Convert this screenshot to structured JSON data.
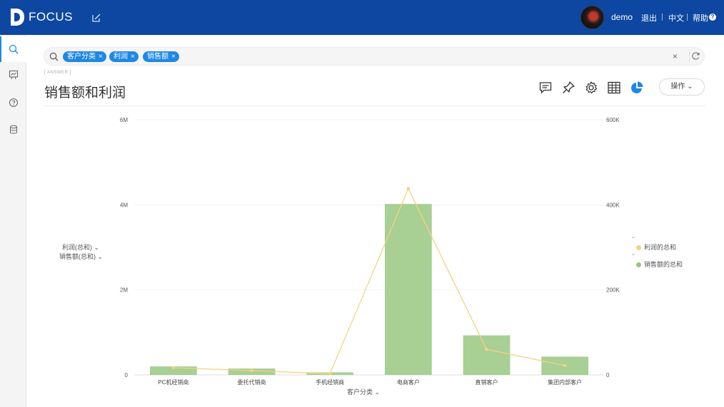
{
  "app": {
    "name": "FOCUS"
  },
  "header": {
    "user": "demo",
    "logout": "退出",
    "language": "中文",
    "help": "帮助",
    "help_mark": "?"
  },
  "search": {
    "tokens": [
      {
        "label": "客户分类"
      },
      {
        "label": "利润"
      },
      {
        "label": "销售额"
      }
    ],
    "clear_glyph": "×"
  },
  "answer_tag": "[ ANSWER ]",
  "page_title": "销售额和利润",
  "toolbar": {
    "ops_label": "操作",
    "ops_caret": "⌄"
  },
  "chart_controls": {
    "y_selectors": [
      "利润(总和)",
      "销售额(总和)"
    ],
    "x_selector": "客户分类"
  },
  "colors": {
    "bar": "#a8cf94",
    "line": "#f5d37f",
    "accent": "#1e88e5",
    "topbar": "#0d47a1"
  },
  "chart_data": {
    "type": "bar",
    "categories": [
      "PC机经销商",
      "委托代销商",
      "手机经销商",
      "电商客户",
      "直销客户",
      "集团内部客户"
    ],
    "series": [
      {
        "name": "销售额的总和",
        "type": "bar",
        "axis": "left",
        "values": [
          200000,
          150000,
          60000,
          4020000,
          930000,
          430000
        ]
      },
      {
        "name": "利润的总和",
        "type": "line",
        "axis": "right",
        "values": [
          17000,
          10000,
          3000,
          438000,
          60000,
          22000
        ]
      }
    ],
    "y_left": {
      "ticks": [
        "0",
        "2M",
        "4M",
        "6M"
      ],
      "ylim": [
        0,
        6000000
      ]
    },
    "y_right": {
      "ticks": [
        "0",
        "200K",
        "400K",
        "600K"
      ],
      "ylim": [
        0,
        600000
      ]
    },
    "xlabel": "客户分类",
    "legend_position": "right",
    "grid": true
  }
}
